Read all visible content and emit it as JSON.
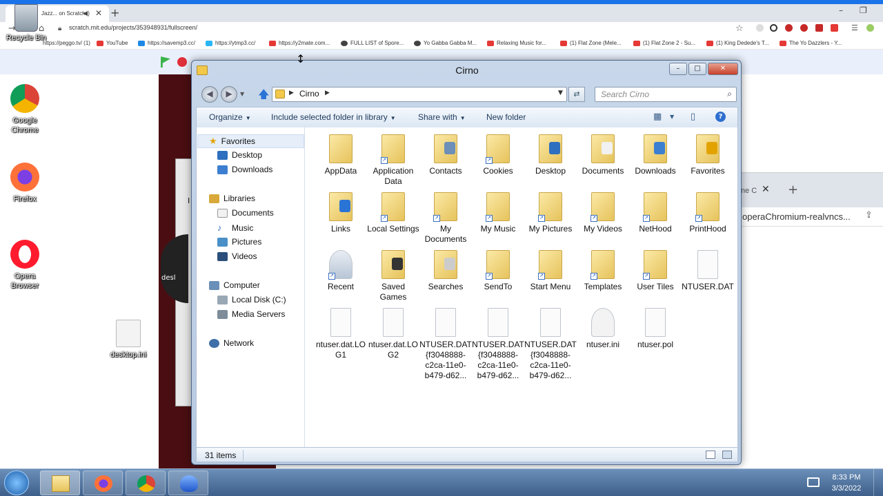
{
  "browser": {
    "tab_title": "Jazz... on Scratch",
    "newtab": "+",
    "url": "scratch.mit.edu/projects/353948931/fullscreen/",
    "bookmarks": [
      "https://peggo.tv/ (1)",
      "YouTube",
      "https://savemp3.cc/",
      "https://ytmp3.cc/",
      "https://y2mate.com...",
      "FULL LIST of Spore...",
      "Yo Gabba Gabba M...",
      "Relaxing Music for...",
      "(1) Flat Zone (Mele...",
      "(1) Flat Zone 2 - Su...",
      "(1) King Dedede's T...",
      "The Yo Dazzlers - Y..."
    ],
    "bookmark_colors": [
      "#e53935",
      "#e53935",
      "#1e88e5",
      "#29b6f6",
      "#e53935",
      "#424242",
      "#424242",
      "#e53935",
      "#e53935",
      "#e53935",
      "#e53935",
      "#e53935"
    ]
  },
  "background_window": {
    "tab_fragment": "ne C",
    "url_fragment": "operaChromium-realvncs..."
  },
  "stage": {
    "partial_label": "desl",
    "partial_char": "I"
  },
  "desktop": {
    "icons": [
      {
        "label": "Recycle Bin"
      },
      {
        "label": "Google Chrome",
        "color": "#4285f4"
      },
      {
        "label": "Firefox",
        "color": "#ff7139"
      },
      {
        "label": "Opera Browser",
        "color": "#ff1b2d"
      },
      {
        "label": "desktop.ini"
      }
    ]
  },
  "explorer": {
    "title": "Cirno",
    "address": "Cirno",
    "search_placeholder": "Search Cirno",
    "toolbar": {
      "organize": "Organize",
      "include_library": "Include selected folder in library",
      "share_with": "Share with",
      "new_folder": "New folder"
    },
    "nav": {
      "favorites": "Favorites",
      "favorites_items": [
        "Desktop",
        "Downloads"
      ],
      "libraries": "Libraries",
      "libraries_items": [
        "Documents",
        "Music",
        "Pictures",
        "Videos"
      ],
      "computer": "Computer",
      "computer_items": [
        "Local Disk (C:)",
        "Media Servers"
      ],
      "network": "Network"
    },
    "files": [
      {
        "name": "AppData",
        "kind": "folder"
      },
      {
        "name": "Application Data",
        "kind": "shortcut-folder"
      },
      {
        "name": "Contacts",
        "kind": "special-folder"
      },
      {
        "name": "Cookies",
        "kind": "shortcut-folder"
      },
      {
        "name": "Desktop",
        "kind": "special-folder"
      },
      {
        "name": "Documents",
        "kind": "special-folder"
      },
      {
        "name": "Downloads",
        "kind": "special-folder"
      },
      {
        "name": "Favorites",
        "kind": "special-folder"
      },
      {
        "name": "Links",
        "kind": "special-folder"
      },
      {
        "name": "Local Settings",
        "kind": "shortcut-folder"
      },
      {
        "name": "My Documents",
        "kind": "shortcut-folder"
      },
      {
        "name": "My Music",
        "kind": "shortcut-folder"
      },
      {
        "name": "My Pictures",
        "kind": "shortcut-folder"
      },
      {
        "name": "My Videos",
        "kind": "shortcut-folder"
      },
      {
        "name": "NetHood",
        "kind": "shortcut-folder"
      },
      {
        "name": "PrintHood",
        "kind": "shortcut-folder"
      },
      {
        "name": "Recent",
        "kind": "shortcut-special"
      },
      {
        "name": "Saved Games",
        "kind": "special-folder"
      },
      {
        "name": "Searches",
        "kind": "special-folder"
      },
      {
        "name": "SendTo",
        "kind": "shortcut-folder"
      },
      {
        "name": "Start Menu",
        "kind": "shortcut-folder"
      },
      {
        "name": "Templates",
        "kind": "shortcut-folder"
      },
      {
        "name": "User Tiles",
        "kind": "shortcut-folder"
      },
      {
        "name": "NTUSER.DAT",
        "kind": "file"
      },
      {
        "name": "ntuser.dat.LOG1",
        "kind": "file"
      },
      {
        "name": "ntuser.dat.LOG2",
        "kind": "file"
      },
      {
        "name": "NTUSER.DAT{f3048888-c2ca-11e0-b479-d62...",
        "kind": "file"
      },
      {
        "name": "NTUSER.DAT{f3048888-c2ca-11e0-b479-d62...",
        "kind": "file"
      },
      {
        "name": "NTUSER.DAT{f3048888-c2ca-11e0-b479-d62...",
        "kind": "file"
      },
      {
        "name": "ntuser.ini",
        "kind": "settings"
      },
      {
        "name": "ntuser.pol",
        "kind": "file"
      }
    ],
    "status": "31 items"
  },
  "taskbar": {
    "time": "8:33 PM",
    "date": "3/3/2022"
  }
}
